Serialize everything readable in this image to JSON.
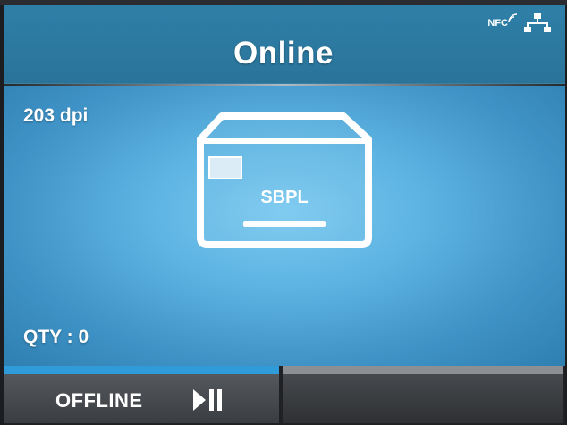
{
  "header": {
    "title": "Online",
    "status_icons": [
      {
        "name": "nfc-icon",
        "label": "NFC"
      },
      {
        "name": "network-icon"
      }
    ]
  },
  "info": {
    "resolution": "203 dpi",
    "quantity": "QTY : 0"
  },
  "media": {
    "icon": "label-media-icon",
    "language": "SBPL"
  },
  "softkeys": {
    "left": {
      "label": "OFFLINE",
      "icon": "play-pause-icon"
    },
    "right": {
      "label": ""
    }
  },
  "colors": {
    "header_bg": "#2e7fa8",
    "main_bg": "#5db4e2",
    "accent_active": "#2f9cd9",
    "accent_inactive": "#8c8f93",
    "softkey_bg": "#3a3d41"
  }
}
